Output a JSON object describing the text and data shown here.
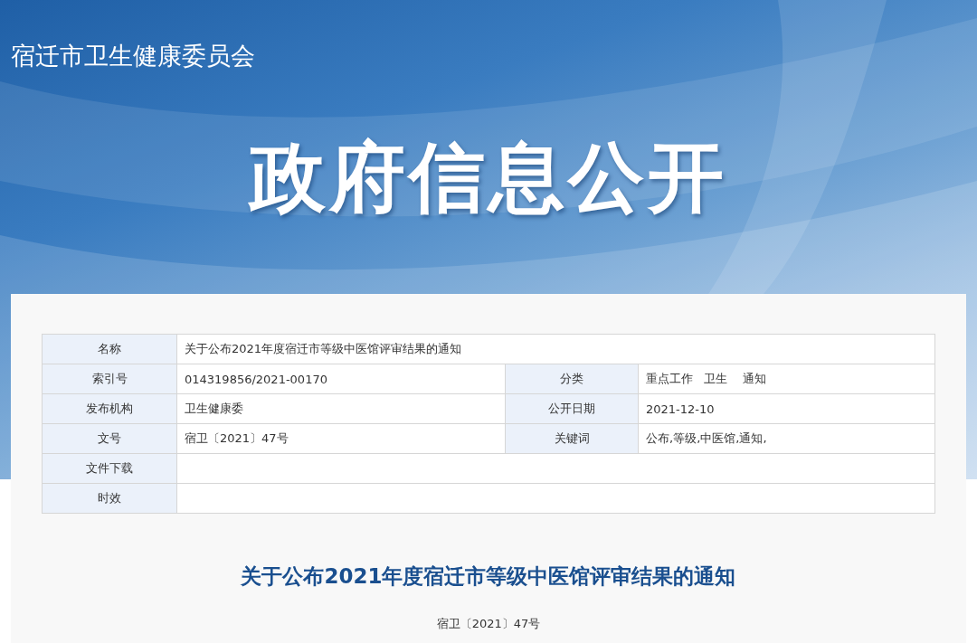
{
  "site_name": "宿迁市卫生健康委员会",
  "banner_title": "政府信息公开",
  "info_table": [
    [
      {
        "label": "名称",
        "value": "关于公布2021年度宿迁市等级中医馆评审结果的通知"
      }
    ],
    [
      {
        "label": "索引号",
        "value": "014319856/2021-00170"
      },
      {
        "label": "分类",
        "value": "重点工作   卫生    通知"
      }
    ],
    [
      {
        "label": "发布机构",
        "value": "卫生健康委"
      },
      {
        "label": "公开日期",
        "value": "2021-12-10"
      }
    ],
    [
      {
        "label": "文号",
        "value": "宿卫〔2021〕47号"
      },
      {
        "label": "关键词",
        "value": "公布,等级,中医馆,通知,"
      }
    ],
    [
      {
        "label": "文件下载"
      }
    ],
    [
      {
        "label": "时效"
      }
    ]
  ],
  "article": {
    "title": "关于公布2021年度宿迁市等级中医馆评审结果的通知",
    "doc_number": "宿卫〔2021〕47号"
  }
}
